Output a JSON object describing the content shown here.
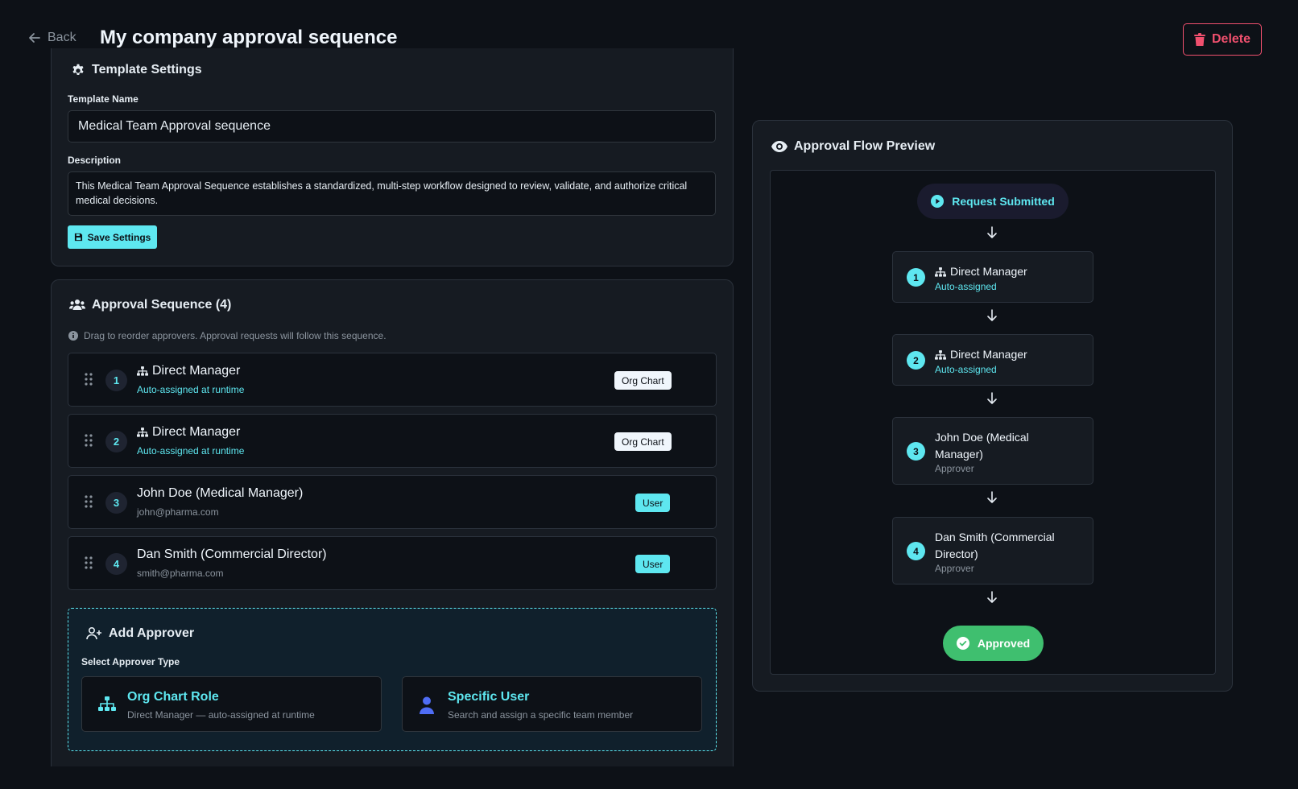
{
  "header": {
    "back_label": "Back",
    "title": "My company approval sequence",
    "delete_label": "Delete"
  },
  "settings": {
    "title": "Template Settings",
    "name_label": "Template Name",
    "name_value": "Medical Team Approval sequence",
    "description_label": "Description",
    "description_value": "This Medical Team Approval Sequence establishes a standardized, multi-step workflow designed to review, validate, and authorize critical medical decisions.",
    "save_label": "Save Settings"
  },
  "sequence": {
    "title": "Approval Sequence (4)",
    "hint": "Drag to reorder approvers. Approval requests will follow this sequence.",
    "approvers": [
      {
        "num": "1",
        "name": "Direct Manager",
        "sub": "Auto-assigned at runtime",
        "badge": "Org Chart"
      },
      {
        "num": "2",
        "name": "Direct Manager",
        "sub": "Auto-assigned at runtime",
        "badge": "Org Chart"
      },
      {
        "num": "3",
        "name": "John Doe (Medical Manager)",
        "sub": "john@pharma.com",
        "badge": "User"
      },
      {
        "num": "4",
        "name": "Dan Smith (Commercial Director)",
        "sub": "smith@pharma.com",
        "badge": "User"
      }
    ]
  },
  "add_approver": {
    "title": "Add Approver",
    "type_label": "Select Approver Type",
    "org_title": "Org Chart Role",
    "org_sub": "Direct Manager — auto-assigned at runtime",
    "user_title": "Specific User",
    "user_sub": "Search and assign a specific team member"
  },
  "preview": {
    "title": "Approval Flow Preview",
    "start_label": "Request Submitted",
    "end_label": "Approved",
    "steps": [
      {
        "num": "1",
        "name": "Direct Manager",
        "sub": "Auto-assigned"
      },
      {
        "num": "2",
        "name": "Direct Manager",
        "sub": "Auto-assigned"
      },
      {
        "num": "3",
        "name": "John Doe (Medical Manager)",
        "sub": "Approver"
      },
      {
        "num": "4",
        "name": "Dan Smith (Commercial Director)",
        "sub": "Approver"
      }
    ]
  },
  "colors": {
    "accent": "#5ee7f0",
    "danger": "#f0506e",
    "success": "#3fbf6f",
    "background": "#0d1117"
  }
}
